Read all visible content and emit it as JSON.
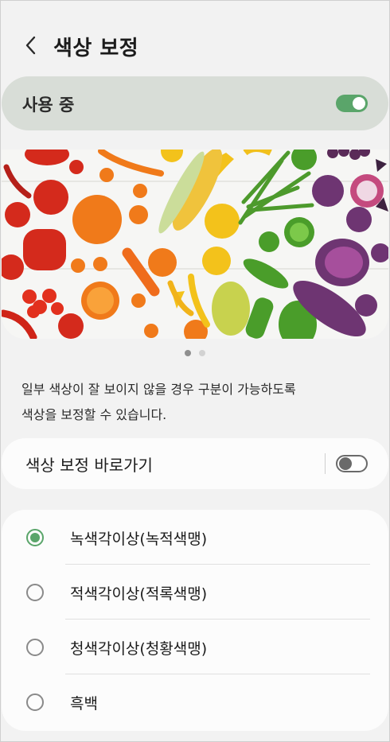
{
  "header": {
    "title": "색상 보정"
  },
  "master_switch": {
    "label": "사용 중",
    "enabled": true
  },
  "banner": {
    "subject": "colorful-fruits-and-vegetables-image"
  },
  "pager": {
    "current_page": 1,
    "total_pages": 2
  },
  "description": {
    "line1": "일부 색상이 잘 보이지 않을 경우 구분이 가능하도록",
    "line2": "색상을 보정할 수 있습니다."
  },
  "shortcut": {
    "label": "색상 보정 바로가기",
    "enabled": false
  },
  "options": [
    {
      "label": "녹색각이상(녹적색맹)",
      "selected": true
    },
    {
      "label": "적색각이상(적록색맹)",
      "selected": false
    },
    {
      "label": "청색각이상(청황색맹)",
      "selected": false
    },
    {
      "label": "흑백",
      "selected": false
    }
  ],
  "colors": {
    "accent": "#5aa56a",
    "master_bg": "#d8ddd7",
    "page_bg": "#f2f2f2",
    "card_bg": "#fcfcfc"
  }
}
